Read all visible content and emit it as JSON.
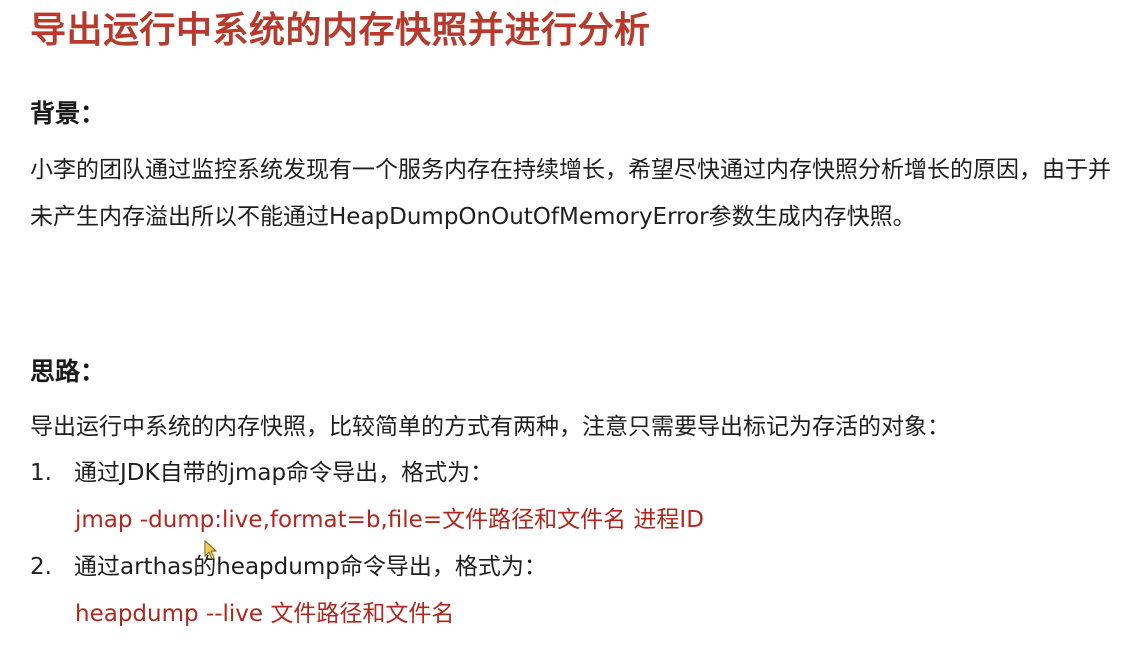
{
  "title": "导出运行中系统的内存快照并进行分析",
  "background": {
    "heading": "背景：",
    "text": "小李的团队通过监控系统发现有一个服务内存在持续增长，希望尽快通过内存快照分析增长的原因，由于并未产生内存溢出所以不能通过HeapDumpOnOutOfMemoryError参数生成内存快照。"
  },
  "approach": {
    "heading": "思路：",
    "intro": "导出运行中系统的内存快照，比较简单的方式有两种，注意只需要导出标记为存活的对象：",
    "items": [
      {
        "number": "1.",
        "text": "通过JDK自带的jmap命令导出，格式为：",
        "command": "jmap -dump:live,format=b,file=文件路径和文件名 进程ID"
      },
      {
        "number": "2.",
        "text": "通过arthas的heapdump命令导出，格式为：",
        "command": "heapdump --live  文件路径和文件名"
      }
    ]
  },
  "colors": {
    "title": "#b83a2c",
    "command": "#b3261e",
    "body_text": "#1f1f1f"
  },
  "icons": {
    "cursor": "mouse-pointer-icon"
  }
}
